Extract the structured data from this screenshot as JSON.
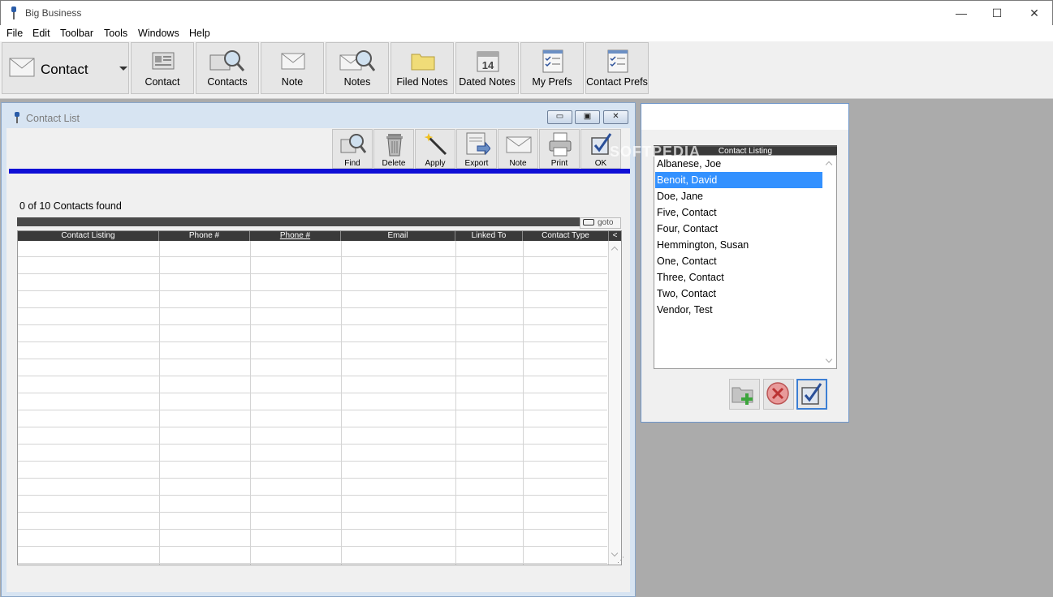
{
  "window": {
    "title": "Big Business",
    "minimize": "—",
    "maximize": "☐",
    "close": "✕"
  },
  "menu": [
    "File",
    "Edit",
    "Toolbar",
    "Tools",
    "Windows",
    "Help"
  ],
  "toolbar": {
    "selector_label": "Contact",
    "buttons": [
      "Contact",
      "Contacts",
      "Note",
      "Notes",
      "Filed Notes",
      "Dated Notes",
      "My Prefs",
      "Contact Prefs"
    ],
    "calendar_day": "14"
  },
  "contact_list": {
    "title": "Contact List",
    "toolbar": [
      "Find",
      "Delete",
      "Apply",
      "Export",
      "Note",
      "Print",
      "OK"
    ],
    "found_text": "0 of 10 Contacts found",
    "goto_label": "goto",
    "columns": [
      "Contact Listing",
      "Phone #",
      "Phone #",
      "Email",
      "Linked To",
      "Contact Type",
      "<"
    ]
  },
  "popup": {
    "header": "Contact Listing",
    "items": [
      "Albanese, Joe",
      "Benoit, David",
      "Doe, Jane",
      "Five, Contact",
      "Four, Contact",
      "Hemmington, Susan",
      "One, Contact",
      "Three, Contact",
      "Two, Contact",
      "Vendor, Test"
    ],
    "selected_index": 1
  },
  "watermark": "SOFTPEDIA",
  "colors": {
    "accent_blue": "#0f0fd6",
    "selection": "#3391ff"
  }
}
